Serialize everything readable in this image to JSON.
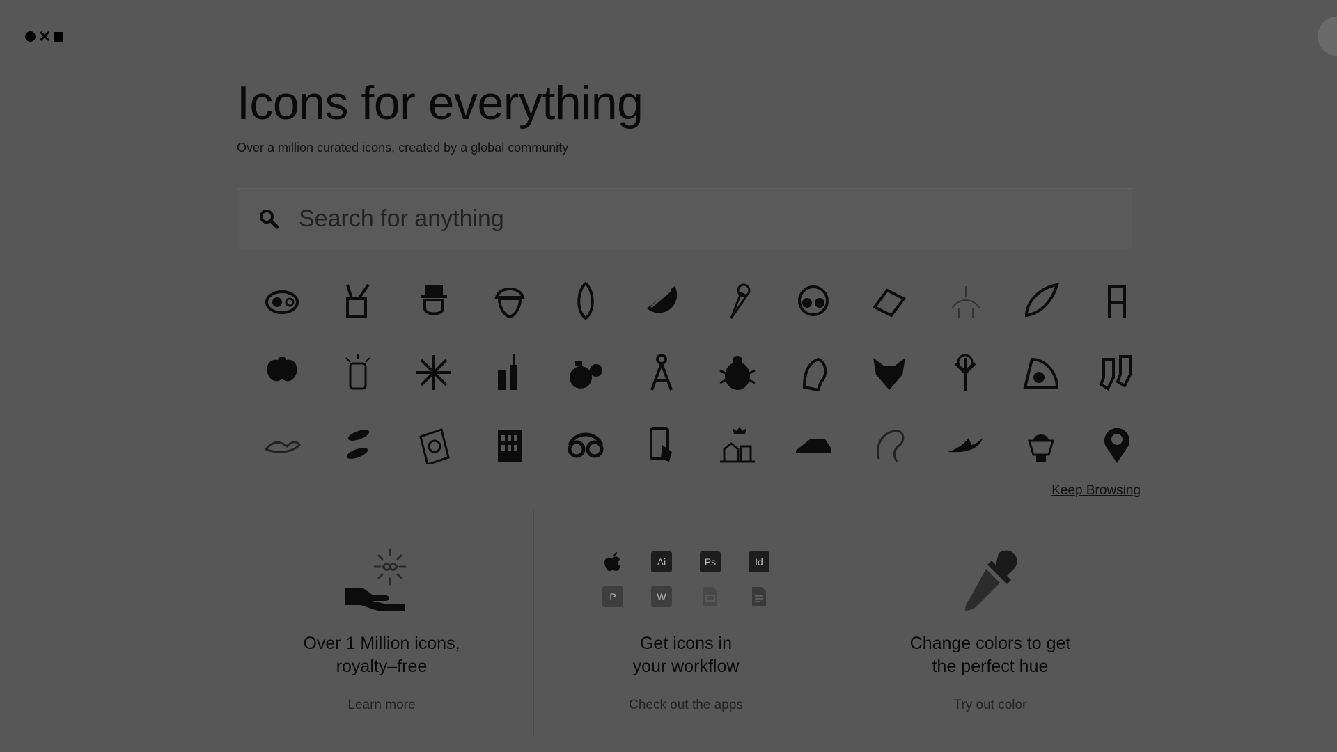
{
  "brand": {
    "logo_label": "Noun Project"
  },
  "hero": {
    "title": "Icons for everything",
    "subtitle": "Over a million curated icons, created by a global community"
  },
  "search": {
    "placeholder": "Search for anything"
  },
  "icon_grid": {
    "icons": [
      "avocado-icon",
      "supplies-icon",
      "leprechaun-icon",
      "acorn-icon",
      "almond-icon",
      "orange-slice-icon",
      "ice-cream-icon",
      "headphones-icon",
      "laptop-icon",
      "horse-rider-icon",
      "horn-icon",
      "chair-icon",
      "scarab-icon",
      "lamp-icon",
      "snowflake-icon",
      "mascara-icon",
      "perfume-icon",
      "compass-icon",
      "ladybug-icon",
      "spartan-icon",
      "fox-icon",
      "tree-icon",
      "eye-mark-icon",
      "socks-icon",
      "creature-icon",
      "nuts-icon",
      "box-icon",
      "building-icon",
      "glasses-icon",
      "phone-icon",
      "village-icon",
      "shoe-icon",
      "lemur-icon",
      "bird-icon",
      "planter-icon",
      "pin-icon"
    ]
  },
  "keep_browsing": "Keep Browsing",
  "features": [
    {
      "title_line1": "Over 1 Million icons,",
      "title_line2": "royalty–free",
      "link": "Learn more"
    },
    {
      "title_line1": "Get icons in",
      "title_line2": "your workflow",
      "link": "Check out the apps"
    },
    {
      "title_line1": "Change colors to get",
      "title_line2": "the perfect hue",
      "link": "Try out color"
    }
  ],
  "apps": [
    "",
    "Ai",
    "Ps",
    "Id",
    "P",
    "W",
    "",
    ""
  ]
}
